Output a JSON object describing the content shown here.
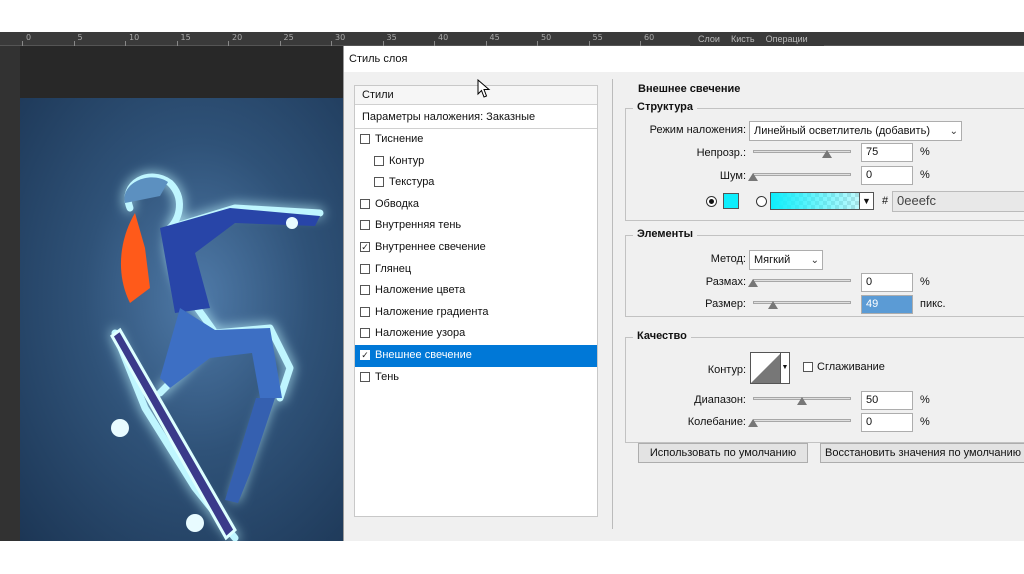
{
  "ruler": {
    "ticks": [
      "0",
      "5",
      "10",
      "15",
      "20",
      "25",
      "30",
      "35",
      "40",
      "45",
      "50",
      "55",
      "60"
    ]
  },
  "panels": {
    "tabs": [
      "Слои",
      "Кисть",
      "Операции"
    ]
  },
  "dialog": {
    "title": "Стиль слоя",
    "styles_header": "Стили",
    "blending_options": "Параметры наложения: Заказные",
    "styles": [
      {
        "label": "Тиснение",
        "checked": false,
        "sub": false,
        "selected": false
      },
      {
        "label": "Контур",
        "checked": false,
        "sub": true,
        "selected": false
      },
      {
        "label": "Текстура",
        "checked": false,
        "sub": true,
        "selected": false
      },
      {
        "label": "Обводка",
        "checked": false,
        "sub": false,
        "selected": false
      },
      {
        "label": "Внутренняя тень",
        "checked": false,
        "sub": false,
        "selected": false
      },
      {
        "label": "Внутреннее свечение",
        "checked": true,
        "sub": false,
        "selected": false
      },
      {
        "label": "Глянец",
        "checked": false,
        "sub": false,
        "selected": false
      },
      {
        "label": "Наложение цвета",
        "checked": false,
        "sub": false,
        "selected": false
      },
      {
        "label": "Наложение градиента",
        "checked": false,
        "sub": false,
        "selected": false
      },
      {
        "label": "Наложение узора",
        "checked": false,
        "sub": false,
        "selected": false
      },
      {
        "label": "Внешнее свечение",
        "checked": true,
        "sub": false,
        "selected": true
      },
      {
        "label": "Тень",
        "checked": false,
        "sub": false,
        "selected": false
      }
    ],
    "outer_glow": {
      "section_title": "Внешнее свечение",
      "structure": {
        "title": "Структура",
        "blend_mode_label": "Режим наложения:",
        "blend_mode_value": "Линейный осветлитель (добавить)",
        "opacity_label": "Непрозр.:",
        "opacity_value": "75",
        "opacity_level": 0.75,
        "opacity_unit": "%",
        "noise_label": "Шум:",
        "noise_value": "0",
        "noise_level": 0,
        "noise_unit": "%",
        "hash": "#",
        "color_hex": "0eeefc",
        "color": "#0eeefc"
      },
      "elements": {
        "title": "Элементы",
        "method_label": "Метод:",
        "method_value": "Мягкий",
        "spread_label": "Размах:",
        "spread_value": "0",
        "spread_level": 0,
        "spread_unit": "%",
        "size_label": "Размер:",
        "size_value": "49",
        "size_level": 0.2,
        "size_unit": "пикс."
      },
      "quality": {
        "title": "Качество",
        "contour_label": "Контур:",
        "antialias_label": "Сглаживание",
        "range_label": "Диапазон:",
        "range_value": "50",
        "range_level": 0.5,
        "range_unit": "%",
        "jitter_label": "Колебание:",
        "jitter_value": "0",
        "jitter_level": 0,
        "jitter_unit": "%"
      },
      "make_default": "Использовать по умолчанию",
      "reset_default": "Восстановить значения по умолчанию"
    }
  },
  "colors": {
    "selection": "#0078d7",
    "glow": "#0eeefc"
  }
}
